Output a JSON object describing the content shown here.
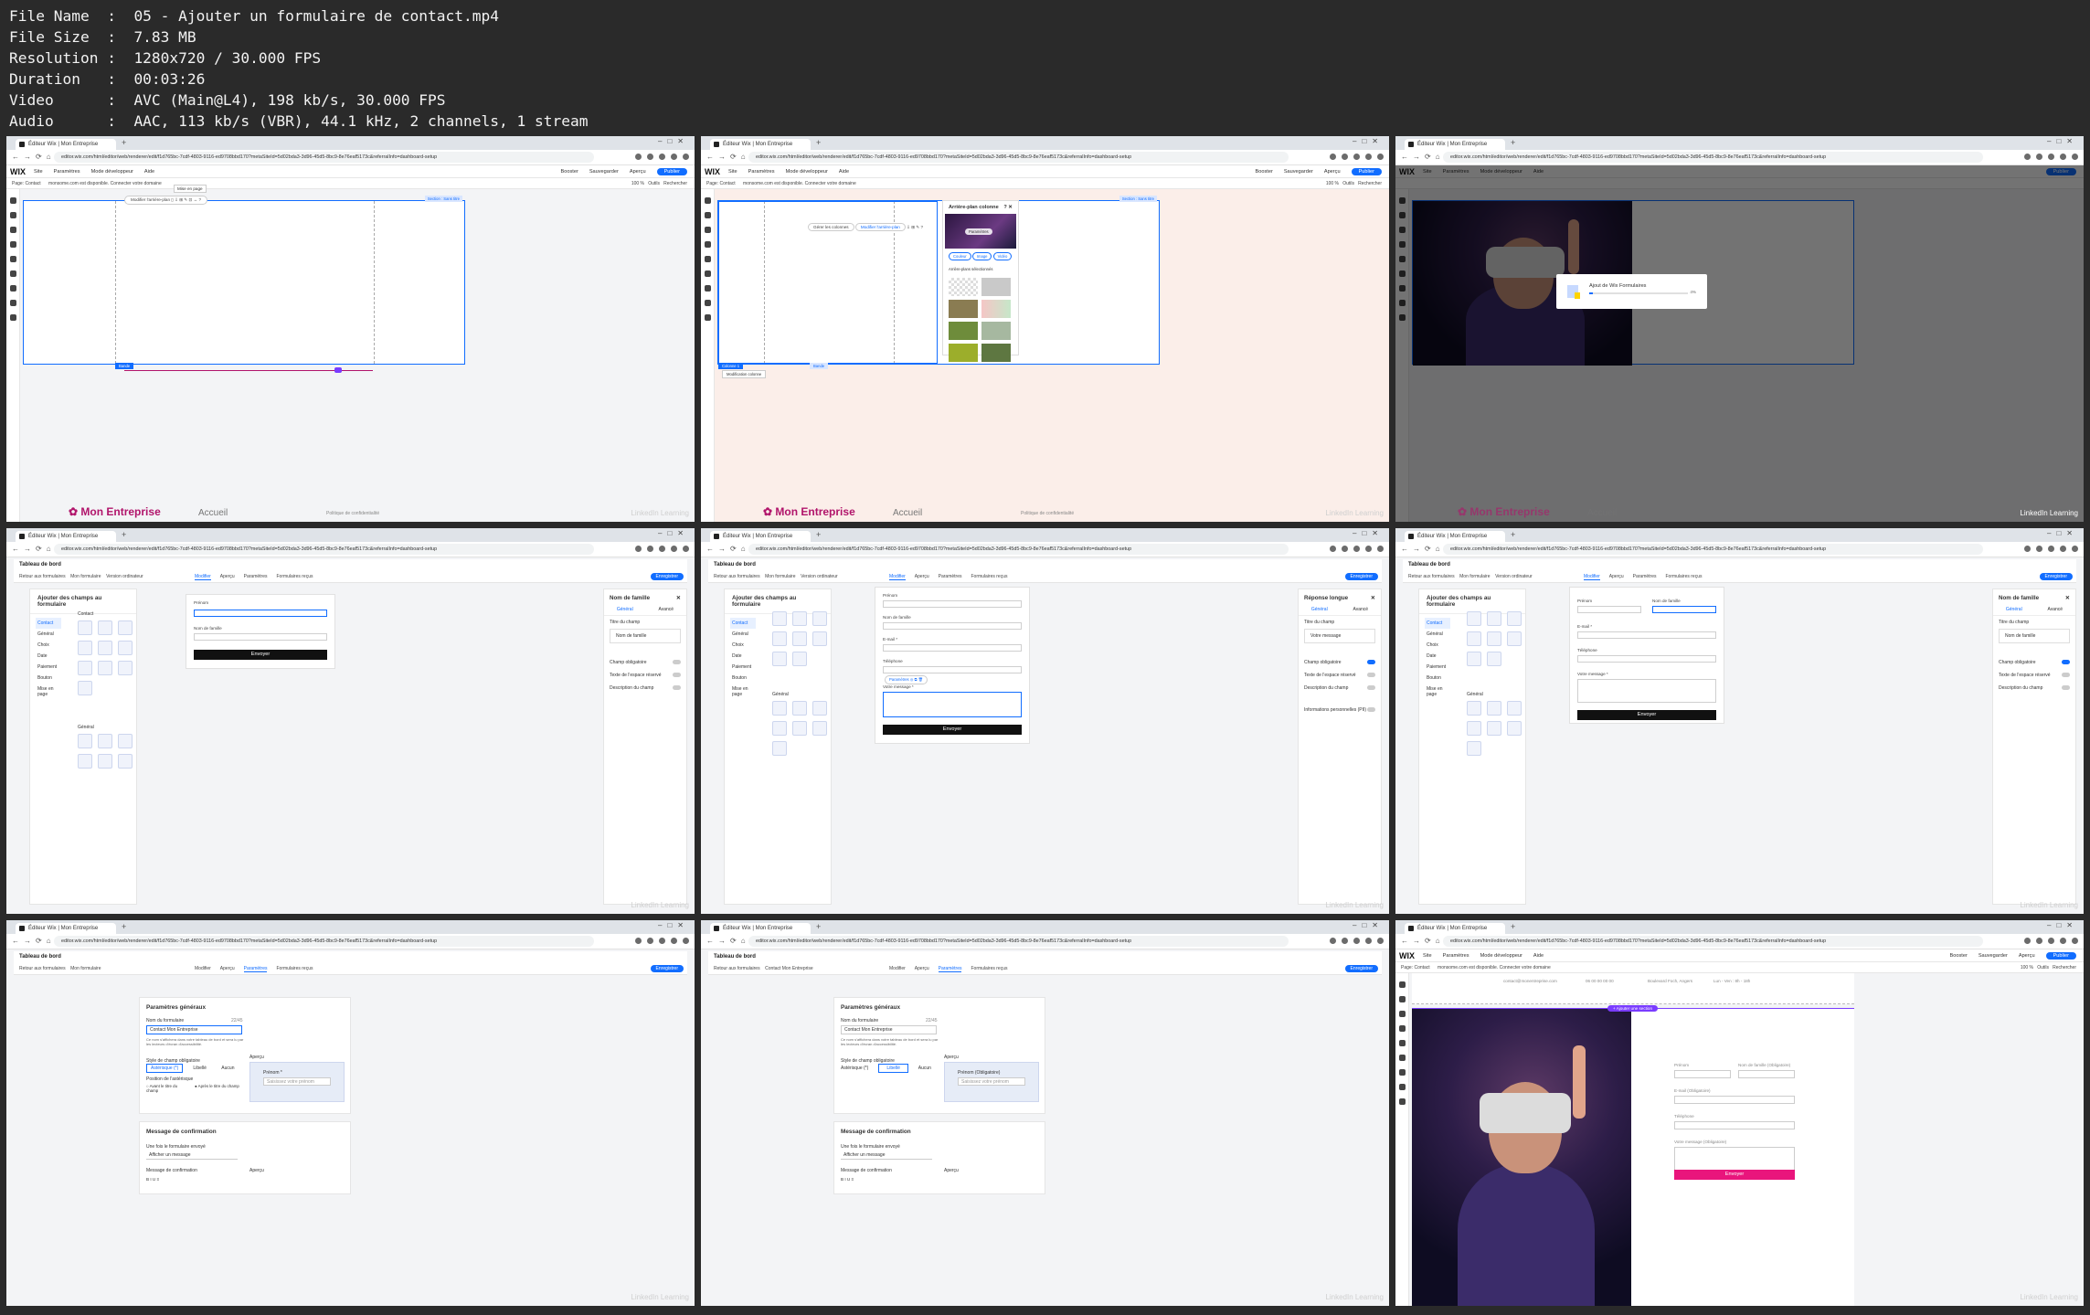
{
  "info": {
    "lines": [
      "File Name  :  05 - Ajouter un formulaire de contact.mp4",
      "File Size  :  7.83 MB",
      "Resolution :  1280x720 / 30.000 FPS",
      "Duration   :  00:03:26",
      "Video      :  AVC (Main@L4), 198 kb/s, 30.000 FPS",
      "Audio      :  AAC, 113 kb/s (VBR), 44.1 kHz, 2 channels, 1 stream"
    ]
  },
  "browser": {
    "tab_title": "Éditeur Wix | Mon Entreprise",
    "url": "editor.wix.com/html/editor/web/renderer/edit/f1d765bc-7cdf-4803-9116-ed9708bbd170?metaSiteId=5d02bda3-3d96-45d5-8bc9-8e76eaf5173c&referralInfo=dashboard-setup"
  },
  "editor": {
    "logo": "WIX",
    "menu": [
      "Site",
      "Paramètres",
      "Mode développeur",
      "Aide"
    ],
    "right_menu": [
      "Booster",
      "Sauvegarder",
      "Aperçu"
    ],
    "publish": "Publier",
    "page_label": "Page:",
    "page_value": "Contact",
    "domain_text": "monsome.com est disponible.",
    "connect_domain": "Connecter votre domaine",
    "zoom": "100 %",
    "tools": "Outils",
    "search": "Rechercher",
    "strip_label": "Modifier l'arrière-plan",
    "tooltip": "Mise en page",
    "section_tag": "Section : Sans titre",
    "bottom_tag": "Bande",
    "brand": "Mon Entreprise",
    "footer_link": "Accueil",
    "privacy": "Politique de confidentialité",
    "watermark": "LinkedIn Learning"
  },
  "bg_panel": {
    "title": "Arrière-plan colonne",
    "settings": "Paramètres",
    "kinds": [
      "Couleur",
      "Image",
      "Vidéo"
    ],
    "selected_label": "Arrière-plans sélectionnés",
    "manage_columns": "Gérer les colonnes",
    "change_bg": "Modifier l'arrière-plan",
    "col_tag": "Colonne 1",
    "modif_label": "Modification colonne"
  },
  "loader": {
    "text": "Ajout de Wix Formulaires",
    "percent": "4%",
    "progress": 0.04
  },
  "dashboard": {
    "title": "Tableau de bord",
    "back": "Retour aux formulaires",
    "form_name": "Mon formulaire",
    "form_name_saved": "Contact Mon Entreprise",
    "view": "Version ordinateur",
    "tabs": [
      "Modifier",
      "Aperçu",
      "Paramètres",
      "Formulaires reçus"
    ],
    "save": "Enregistrer"
  },
  "fields_panel": {
    "title": "Ajouter des champs au formulaire",
    "categories": [
      "Contact",
      "Général",
      "Choix",
      "Date",
      "Paiement",
      "Bouton",
      "Mise en page"
    ],
    "contact_header": "Contact",
    "general_header": "Général",
    "field_names": [
      "Prénom",
      "Nom de famille",
      "E-mail",
      "Téléphone",
      "Adresse",
      "Entreprise"
    ]
  },
  "form": {
    "labels": [
      "Prénom",
      "Nom de famille",
      "E-mail *",
      "Téléphone",
      "Votre message *"
    ],
    "button": "Envoyer",
    "field_settings": "Paramètres"
  },
  "right_panels": {
    "nom": {
      "title": "Nom de famille",
      "tabs": [
        "Général",
        "Avancé"
      ],
      "title_field": "Titre du champ",
      "title_value": "Nom de famille",
      "rows": [
        "Champ obligatoire",
        "Texte de l'espace réservé",
        "Description du champ"
      ]
    },
    "reponse": {
      "title": "Réponse longue",
      "tabs": [
        "Général",
        "Avancé"
      ],
      "title_field": "Titre du champ",
      "title_value": "Votre message",
      "rows": [
        "Champ obligatoire",
        "Texte de l'espace réservé",
        "Description du champ",
        "Informations personnelles (PII)"
      ]
    }
  },
  "settings": {
    "title": "Paramètres généraux",
    "name_label": "Nom du formulaire",
    "name_count": "22/45",
    "name_help": "Ce nom s'affichera dans votre tableau de bord et sera lu par les lecteurs d'écran d'accessibilité.",
    "style_label": "Style de champ obligatoire",
    "style_options": [
      "Astérisque (*)",
      "Libellé",
      "Aucun"
    ],
    "preview_label": "Aperçu",
    "position_label": "Position de l'astérisque",
    "position_options": [
      "Avant le titre du champ",
      "Après le titre du champ"
    ],
    "preview_field": "Prénom *",
    "preview_field_alt": "Prénom (Obligatoire)",
    "preview_placeholder": "Saisissez votre prénom",
    "confirm_title": "Message de confirmation",
    "confirm_after": "Une fois le formulaire envoyé",
    "confirm_value": "Afficher un message",
    "confirm_msg": "Message de confirmation"
  },
  "final": {
    "add_section": "+ Ajouter une section",
    "info_strip": [
      "contact@monentreprise.com",
      "06 00 00 00 00",
      "Boulevard Foch, Angers",
      "Lun - Ven : 8h - 18h"
    ],
    "labels": [
      "Prénom",
      "Nom de famille (Obligatoire)",
      "E-mail (Obligatoire)",
      "Téléphone",
      "Votre message (Obligatoire)"
    ],
    "button": "Envoyer"
  }
}
